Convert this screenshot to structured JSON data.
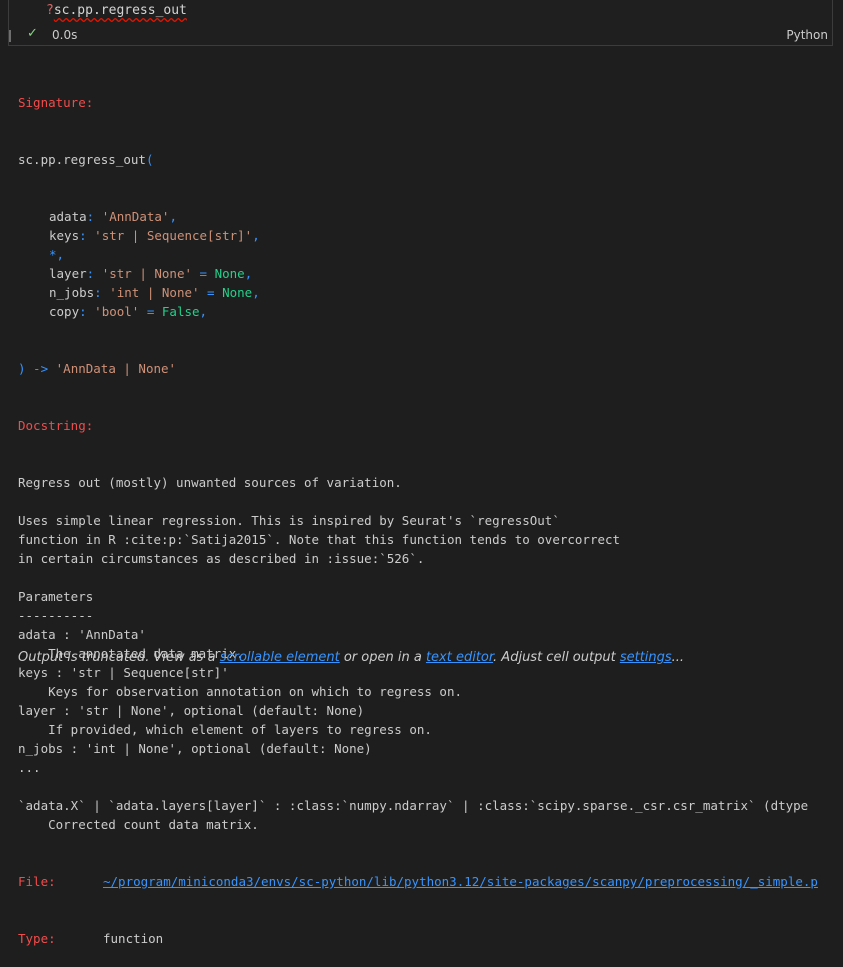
{
  "cell": {
    "code_prefix": "?",
    "code_expr": "sc.pp.regress_out",
    "duration": "0.0s",
    "language": "Python"
  },
  "output": {
    "signature_label": "Signature:",
    "sig_head_pre": "sc.pp.regress_out",
    "sig_open": "(",
    "params": [
      {
        "name": "adata",
        "colon": ":",
        "type": "'AnnData'",
        "tail": ","
      },
      {
        "name": "keys",
        "colon": ":",
        "type": "'str | Sequence[str]'",
        "tail": ","
      },
      {
        "name": "*",
        "colon": "",
        "type": "",
        "tail": ","
      },
      {
        "name": "layer",
        "colon": ":",
        "type": "'str | None'",
        "eq": " = ",
        "default": "None",
        "tail": ","
      },
      {
        "name": "n_jobs",
        "colon": ":",
        "type": "'int | None'",
        "eq": " = ",
        "default": "None",
        "tail": ","
      },
      {
        "name": "copy",
        "colon": ":",
        "type": "'bool'",
        "eq": " = ",
        "default": "False",
        "tail": ","
      }
    ],
    "sig_close": ") -> 'AnnData | None'",
    "docstring_label": "Docstring:",
    "doc_lines": [
      "Regress out (mostly) unwanted sources of variation.",
      "",
      "Uses simple linear regression. This is inspired by Seurat's `regressOut`",
      "function in R :cite:p:`Satija2015`. Note that this function tends to overcorrect",
      "in certain circumstances as described in :issue:`526`.",
      "",
      "Parameters",
      "----------",
      "adata : 'AnnData'",
      "    The annotated data matrix.",
      "keys : 'str | Sequence[str]'",
      "    Keys for observation annotation on which to regress on.",
      "layer : 'str | None', optional (default: None)",
      "    If provided, which element of layers to regress on.",
      "n_jobs : 'int | None', optional (default: None)",
      "...",
      "",
      "`adata.X` | `adata.layers[layer]` : :class:`numpy.ndarray` | :class:`scipy.sparse._csr.csr_matrix` (dtype",
      "    Corrected count data matrix."
    ],
    "file_label": "File:",
    "file_path": "~/program/miniconda3/envs/sc-python/lib/python3.12/site-packages/scanpy/preprocessing/_simple.p",
    "type_label": "Type:",
    "type_value": "function"
  },
  "footer": {
    "text1": "Output is truncated. View as a ",
    "link1": "scrollable element",
    "text2": " or open in a ",
    "link2": "text editor",
    "text3": ". Adjust cell output ",
    "link3": "settings",
    "text4": "..."
  },
  "colors": {
    "background": "#1e1e1e",
    "label_red": "#f14c4c",
    "string": "#ce9178",
    "keyword_blue": "#3794ff",
    "constant_green": "#23d18b",
    "link": "#3794ff",
    "success": "#89d185"
  }
}
